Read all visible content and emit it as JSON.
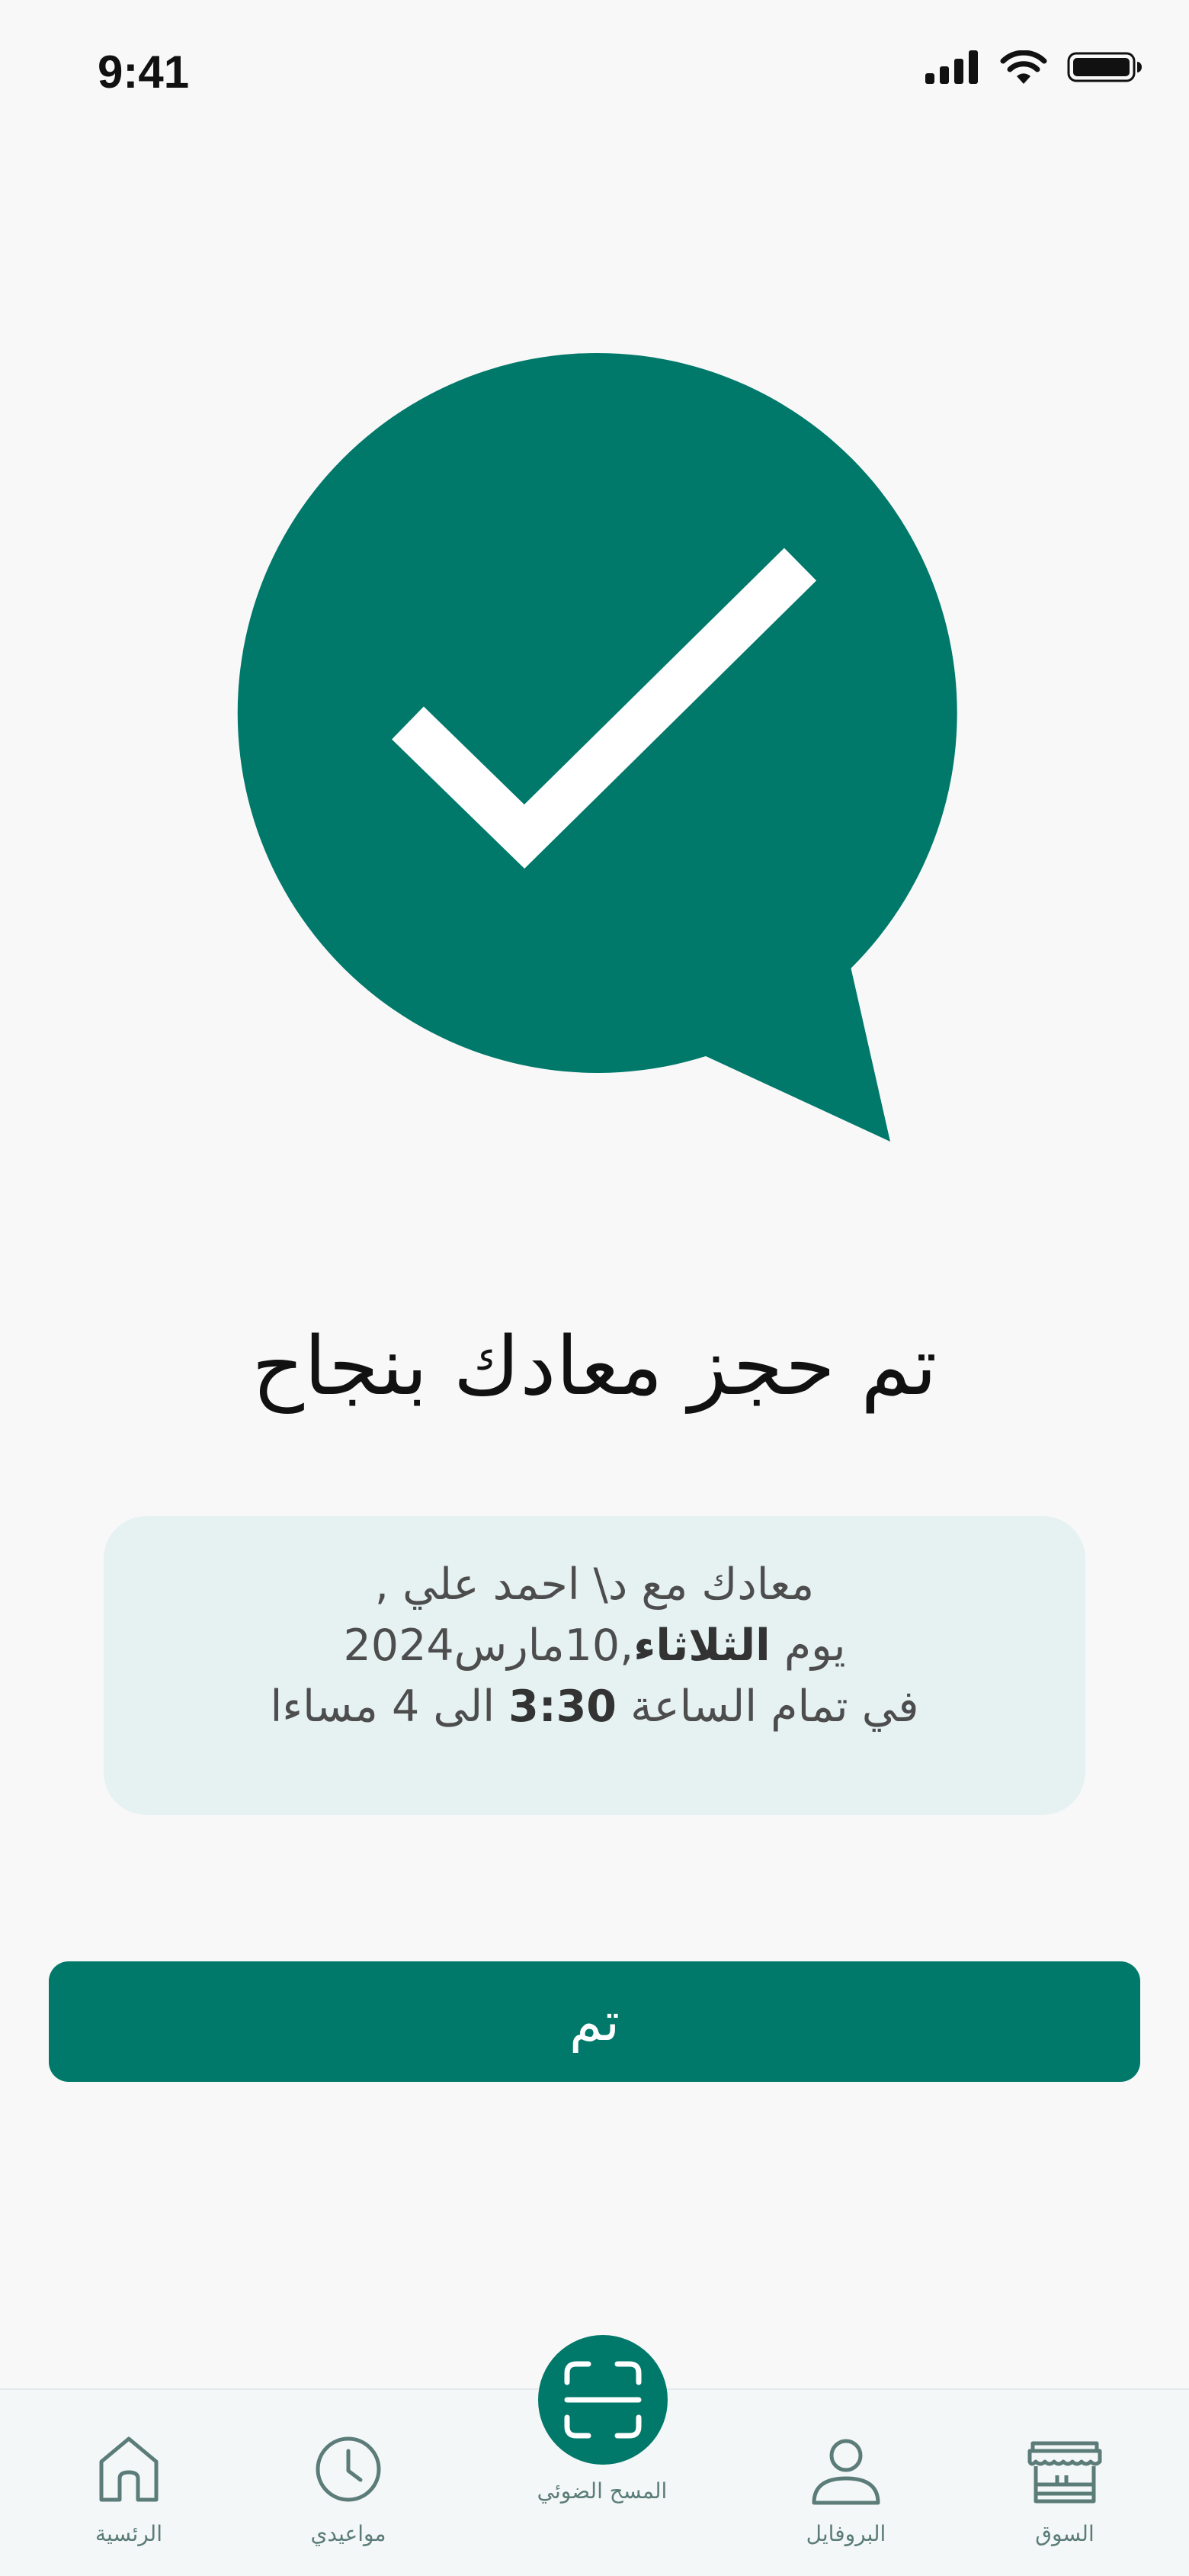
{
  "status_bar": {
    "time": "9:41"
  },
  "confirmation": {
    "title": "تم حجز معادك بنجاح",
    "details": {
      "line1": "معادك مع د\\ احمد علي ,",
      "line2_prefix": "يوم ",
      "line2_day": "الثلاثاء",
      "line2_date": ",10مارس2024",
      "line3_prefix": "في تمام الساعة ",
      "line3_time": "3:30",
      "line3_suffix": " الى 4 مساءا"
    },
    "done_label": "تم"
  },
  "bottom_nav": {
    "market": "السوق",
    "profile": "البروفايل",
    "scan": "المسح الضوئي",
    "appointments": "مواعيدي",
    "home": "الرئسية"
  },
  "colors": {
    "accent": "#00786A",
    "card_background": "#E6F2F2",
    "nav_label": "#5B7C78"
  },
  "icons": [
    "check-bubble-icon",
    "store-icon",
    "person-icon",
    "scan-icon",
    "clock-icon",
    "home-icon"
  ]
}
